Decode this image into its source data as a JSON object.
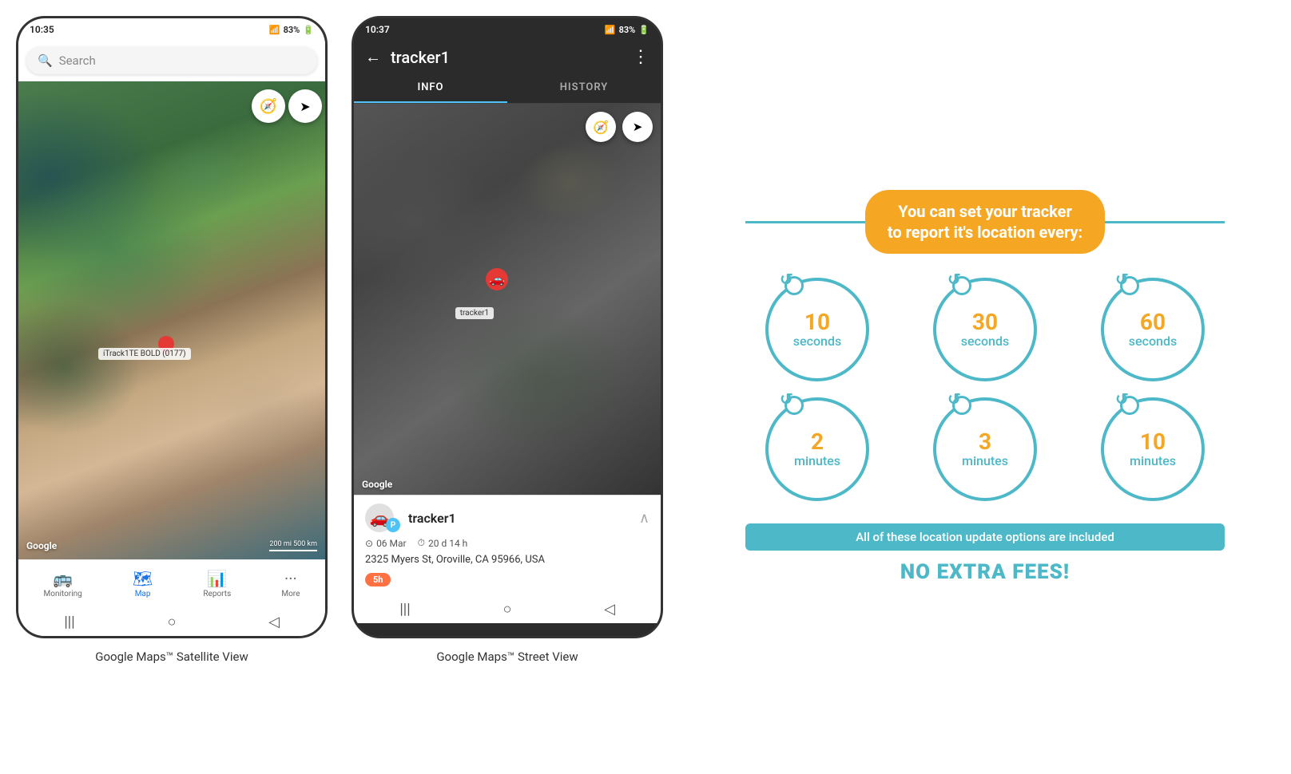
{
  "phone1": {
    "status_bar": {
      "time": "10:35",
      "signal": "▲▼",
      "network": ".ıll",
      "battery": "83%"
    },
    "search_placeholder": "Search",
    "map": {
      "label": "iTrack1TE BOLD (0177)",
      "google_text": "Google",
      "scale_text": "200 mi\n500 km"
    },
    "nav": {
      "items": [
        {
          "icon": "🚌",
          "label": "Monitoring"
        },
        {
          "icon": "🗺",
          "label": "Map",
          "active": true
        },
        {
          "icon": "📊",
          "label": "Reports"
        },
        {
          "icon": "···",
          "label": "More"
        }
      ]
    },
    "caption": "Google Maps™ Satellite View"
  },
  "phone2": {
    "status_bar": {
      "time": "10:37",
      "signal": "▲▼",
      "network": ".ıll",
      "battery": "83%"
    },
    "header": {
      "title": "tracker1",
      "back_icon": "←",
      "more_icon": "⋮"
    },
    "tabs": [
      {
        "label": "INFO",
        "active": true
      },
      {
        "label": "HISTORY",
        "active": false
      }
    ],
    "map": {
      "label": "tracker1",
      "google_text": "Google"
    },
    "tracker_info": {
      "name": "tracker1",
      "p_badge": "P",
      "date": "06 Mar",
      "duration": "20 d 14 h",
      "address": "2325 Myers St, Oroville, CA 95966, USA",
      "badge_label": "5h"
    },
    "caption": "Google Maps™ Street View"
  },
  "promo": {
    "header_line1": "You can set your tracker",
    "header_line2": "to report it's location every:",
    "circles": [
      {
        "number": "10",
        "unit": "seconds"
      },
      {
        "number": "30",
        "unit": "seconds"
      },
      {
        "number": "60",
        "unit": "seconds"
      },
      {
        "number": "2",
        "unit": "minutes"
      },
      {
        "number": "3",
        "unit": "minutes"
      },
      {
        "number": "10",
        "unit": "minutes"
      }
    ],
    "note": "All of these location update options are included",
    "tagline": "NO EXTRA FEES!",
    "accent_color": "#f5a623",
    "blue_color": "#4db8c8"
  }
}
